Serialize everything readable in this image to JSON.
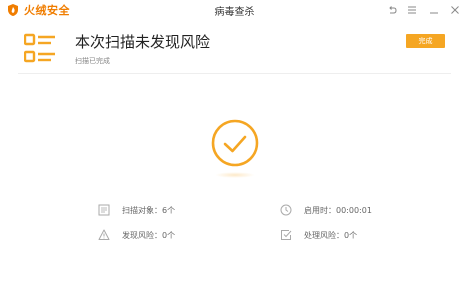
{
  "window": {
    "brand": "火绒安全",
    "title": "病毒查杀",
    "controls": [
      "back",
      "menu",
      "minimize",
      "close"
    ]
  },
  "header": {
    "headline": "本次扫描未发现风险",
    "status": "扫描已完成",
    "done_button": "完成"
  },
  "colors": {
    "accent": "#f5a623",
    "brand": "#f07d00",
    "text_muted": "#888888"
  },
  "stats": {
    "scan_objects": {
      "label": "扫描对象",
      "sep": "：",
      "value": "6个"
    },
    "risks_found": {
      "label": "发现风险",
      "sep": "：",
      "value": "0个"
    },
    "elapsed": {
      "label": "启用时",
      "sep": "：",
      "value": "00:00:01"
    },
    "risks_handled": {
      "label": "处理风险",
      "sep": "：",
      "value": "0个"
    }
  },
  "icons": {
    "brand": "flame-shield-icon",
    "report": "report-list-icon",
    "result": "check-circle-icon",
    "scan_objects": "document-icon",
    "risks_found": "warning-icon",
    "elapsed": "clock-icon",
    "risks_handled": "handled-checkbox-icon"
  }
}
